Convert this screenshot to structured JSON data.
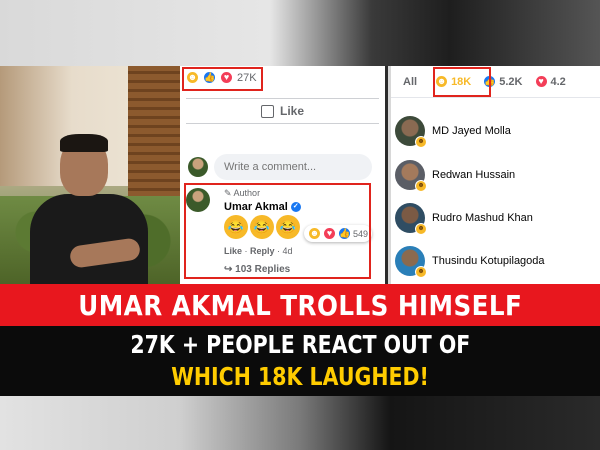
{
  "post": {
    "reaction_count": "27K",
    "like_label": "Like",
    "comment_placeholder": "Write a comment..."
  },
  "comment": {
    "author_tag": "Author",
    "name": "Umar Akmal",
    "emojis": [
      "😂",
      "😂",
      "😂"
    ],
    "reaction_count": "549",
    "action_like": "Like",
    "action_reply": "Reply",
    "time": "4d",
    "replies": "103 Replies"
  },
  "reactions_panel": {
    "tabs": [
      {
        "label": "All"
      },
      {
        "icon": "haha-icon",
        "count": "18K"
      },
      {
        "icon": "like-icon",
        "count": "5.2K"
      },
      {
        "icon": "love-icon",
        "count": "4.2"
      }
    ],
    "people": [
      {
        "name": "MD Jayed Molla"
      },
      {
        "name": "Redwan Hussain"
      },
      {
        "name": "Rudro Mashud Khan"
      },
      {
        "name": "Thusindu Kotupilagoda"
      }
    ]
  },
  "headline": {
    "line1": "UMAR AKMAL TROLLS HIMSELF",
    "line2": "27K + PEOPLE REACT OUT OF",
    "line3": "WHICH 18K LAUGHED!"
  },
  "colors": {
    "banner_red": "#e8171e",
    "highlight_yellow": "#ffcc00",
    "fb_blue": "#1877f2",
    "haha_yellow": "#f7b928",
    "box_red": "#e0241d"
  }
}
